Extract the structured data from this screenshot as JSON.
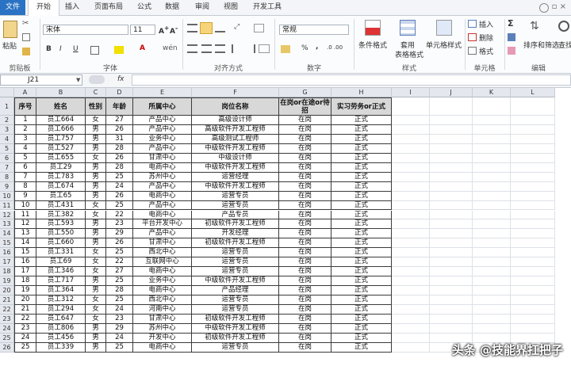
{
  "tabs": [
    "文件",
    "开始",
    "插入",
    "页面布局",
    "公式",
    "数据",
    "审阅",
    "视图",
    "开发工具"
  ],
  "ribbon": {
    "paste": "粘贴",
    "clipboard": "剪贴板",
    "font_name": "宋体",
    "font_size": "11",
    "font_group": "字体",
    "wen": "wén",
    "align_group": "对齐方式",
    "number_format": "常规",
    "number_group": "数字",
    "percent": "%",
    "comma": ",",
    "cond_format_1": "条件格式",
    "table_format_1": "套用",
    "table_format_2": "表格格式",
    "cell_style": "单元格样式",
    "style_group": "样式",
    "insert": "插入",
    "delete": "删除",
    "format": "格式",
    "cells_group": "单元格",
    "sort_filter": "排序和筛选",
    "find_select": "查找",
    "edit_group": "编辑",
    "bold": "B",
    "italic": "I",
    "underline": "U",
    "font_color_letter": "A",
    "sigma": "Σ"
  },
  "formula_bar": {
    "name_box": "J21",
    "fx": "fx"
  },
  "sheet": {
    "columns": [
      "A",
      "B",
      "C",
      "D",
      "E",
      "F",
      "G",
      "H",
      "I",
      "J",
      "K",
      "L"
    ],
    "headers": [
      "序号",
      "姓名",
      "性别",
      "年龄",
      "所属中心",
      "岗位名称",
      "在岗or在途or待招",
      "实习劳务or正式"
    ],
    "rows": [
      [
        "1",
        "员工664",
        "女",
        "27",
        "产品中心",
        "高级设计师",
        "在岗",
        "正式"
      ],
      [
        "2",
        "员工666",
        "男",
        "26",
        "产品中心",
        "高级软件开发工程师",
        "在岗",
        "正式"
      ],
      [
        "3",
        "员工757",
        "男",
        "31",
        "业务中心",
        "高级测试工程师",
        "在岗",
        "正式"
      ],
      [
        "4",
        "员工527",
        "男",
        "28",
        "产品中心",
        "中级软件开发工程师",
        "在岗",
        "正式"
      ],
      [
        "5",
        "员工655",
        "女",
        "26",
        "甘肃中心",
        "中级设计师",
        "在岗",
        "正式"
      ],
      [
        "6",
        "员工29",
        "男",
        "28",
        "电商中心",
        "中级软件开发工程师",
        "在岗",
        "正式"
      ],
      [
        "7",
        "员工783",
        "男",
        "25",
        "苏州中心",
        "运营经理",
        "在岗",
        "正式"
      ],
      [
        "8",
        "员工674",
        "男",
        "24",
        "产品中心",
        "中级软件开发工程师",
        "在岗",
        "正式"
      ],
      [
        "9",
        "员工65",
        "男",
        "26",
        "电商中心",
        "运营专员",
        "在岗",
        "正式"
      ],
      [
        "10",
        "员工431",
        "女",
        "25",
        "产品中心",
        "运营专员",
        "在岗",
        "正式"
      ],
      [
        "11",
        "员工382",
        "女",
        "22",
        "电商中心",
        "产品专员",
        "在岗",
        "正式"
      ],
      [
        "12",
        "员工593",
        "男",
        "23",
        "平台开发中心",
        "初级软件开发工程师",
        "在岗",
        "正式"
      ],
      [
        "13",
        "员工550",
        "男",
        "29",
        "产品中心",
        "开发经理",
        "在岗",
        "正式"
      ],
      [
        "14",
        "员工660",
        "男",
        "26",
        "甘肃中心",
        "初级软件开发工程师",
        "在岗",
        "正式"
      ],
      [
        "15",
        "员工331",
        "女",
        "25",
        "西北中心",
        "运营专员",
        "在岗",
        "正式"
      ],
      [
        "16",
        "员工69",
        "女",
        "22",
        "互联网中心",
        "运营专员",
        "在岗",
        "正式"
      ],
      [
        "17",
        "员工346",
        "女",
        "27",
        "电商中心",
        "运营专员",
        "在岗",
        "正式"
      ],
      [
        "18",
        "员工717",
        "男",
        "25",
        "业务中心",
        "中级软件开发工程师",
        "在岗",
        "正式"
      ],
      [
        "19",
        "员工364",
        "男",
        "28",
        "电商中心",
        "产品经理",
        "在岗",
        "正式"
      ],
      [
        "20",
        "员工312",
        "女",
        "25",
        "西北中心",
        "运营专员",
        "在岗",
        "正式"
      ],
      [
        "21",
        "员工294",
        "女",
        "24",
        "河南中心",
        "运营专员",
        "在岗",
        "正式"
      ],
      [
        "22",
        "员工647",
        "女",
        "23",
        "甘肃中心",
        "初级软件开发工程师",
        "在岗",
        "正式"
      ],
      [
        "23",
        "员工806",
        "男",
        "29",
        "苏州中心",
        "中级软件开发工程师",
        "在岗",
        "正式"
      ],
      [
        "24",
        "员工456",
        "男",
        "24",
        "开发中心",
        "初级软件开发工程师",
        "在岗",
        "正式"
      ],
      [
        "25",
        "员工339",
        "男",
        "25",
        "电商中心",
        "运营专员",
        "在岗",
        "正式"
      ]
    ]
  },
  "watermark": "头条 @技能界扛把子",
  "colors": {
    "file_tab": "#2a72c3",
    "header_fill": "#d8d8d8"
  }
}
